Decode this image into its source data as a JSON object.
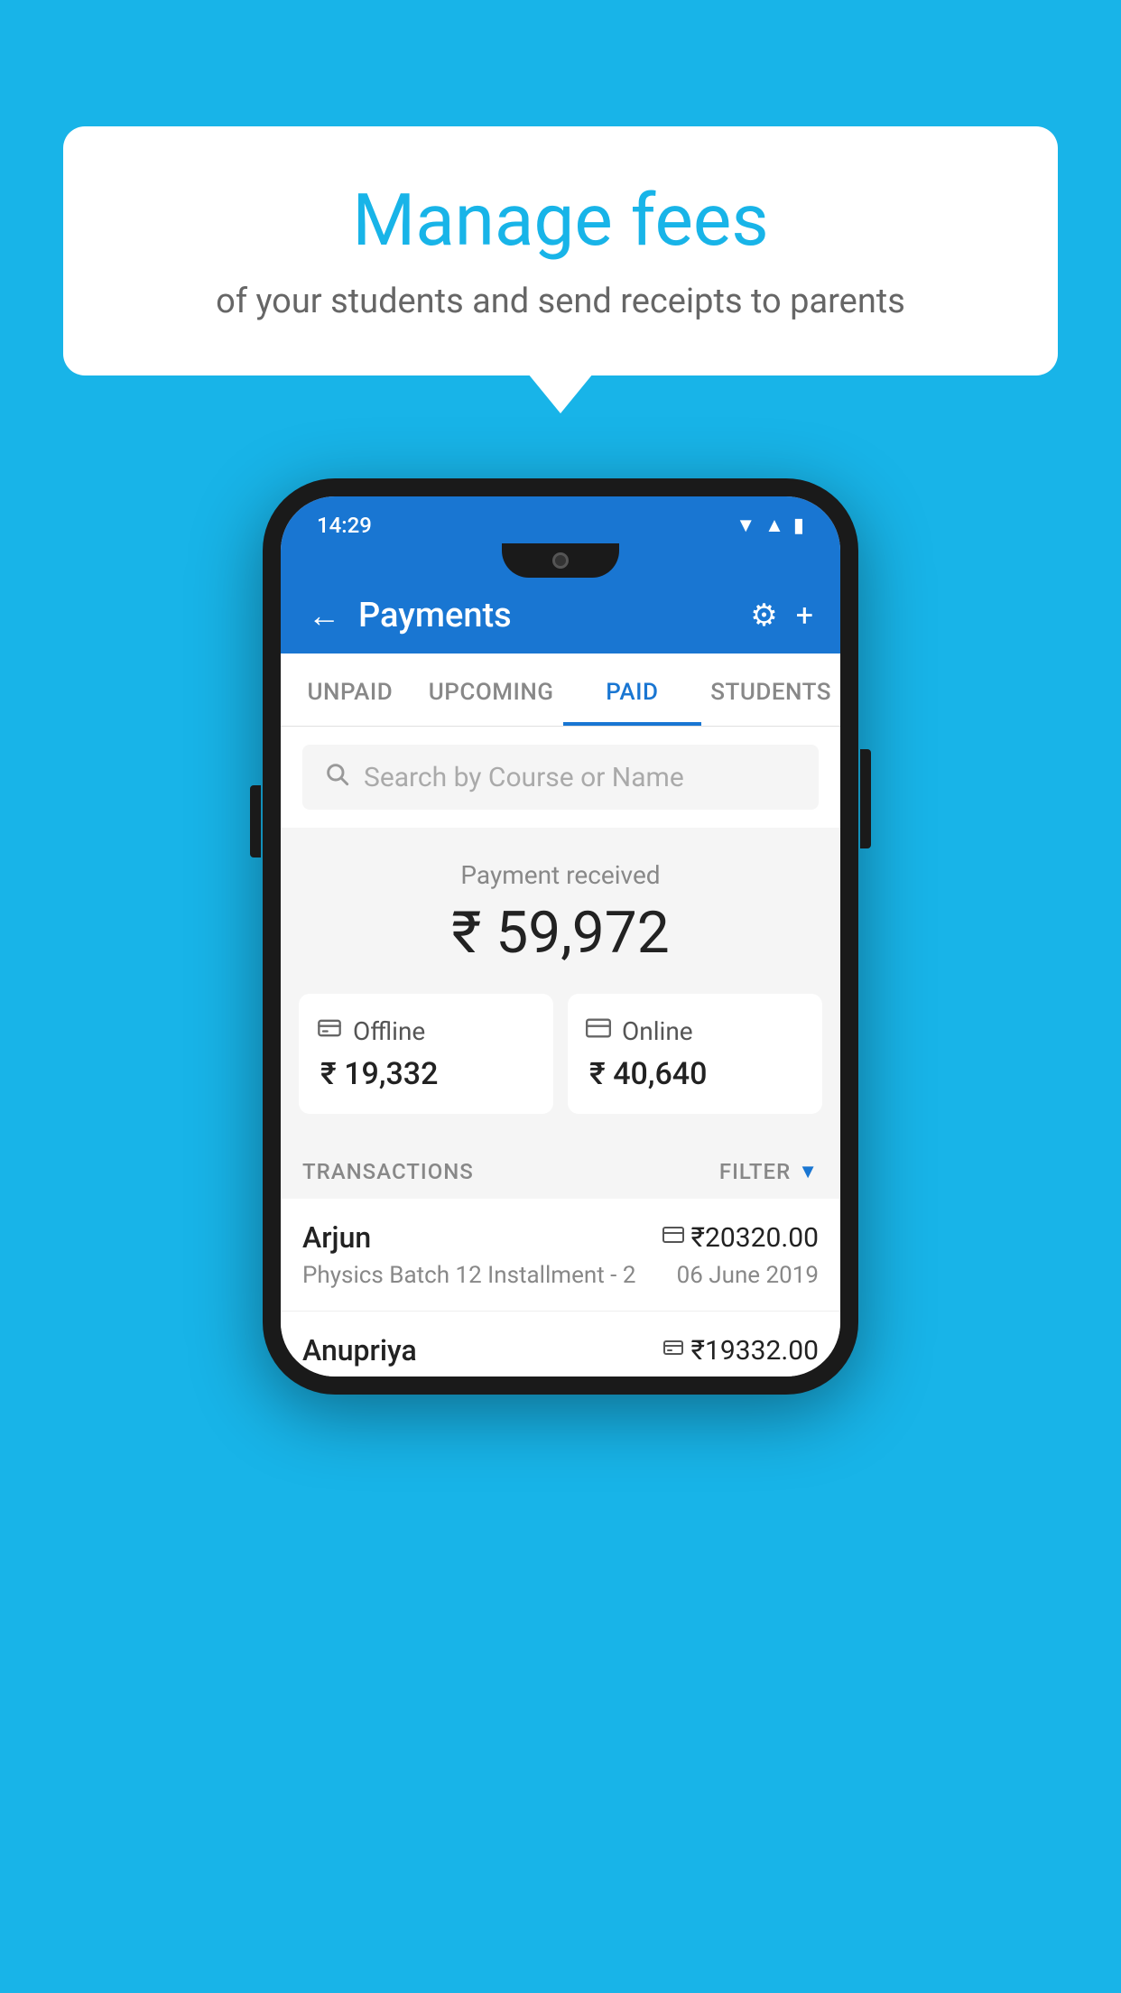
{
  "background_color": "#18b4e8",
  "speech_bubble": {
    "title": "Manage fees",
    "subtitle": "of your students and send receipts to parents"
  },
  "status_bar": {
    "time": "14:29",
    "wifi": "▼",
    "signal": "▲",
    "battery": "▮"
  },
  "app_bar": {
    "title": "Payments",
    "back_label": "←",
    "gear_label": "⚙",
    "plus_label": "+"
  },
  "tabs": [
    {
      "label": "UNPAID",
      "active": false
    },
    {
      "label": "UPCOMING",
      "active": false
    },
    {
      "label": "PAID",
      "active": true
    },
    {
      "label": "STUDENTS",
      "active": false
    }
  ],
  "search": {
    "placeholder": "Search by Course or Name"
  },
  "payment_summary": {
    "label": "Payment received",
    "amount": "₹ 59,972",
    "offline": {
      "label": "Offline",
      "amount": "₹ 19,332"
    },
    "online": {
      "label": "Online",
      "amount": "₹ 40,640"
    }
  },
  "transactions": {
    "section_label": "TRANSACTIONS",
    "filter_label": "FILTER",
    "items": [
      {
        "name": "Arjun",
        "course": "Physics Batch 12 Installment - 2",
        "amount": "₹20320.00",
        "date": "06 June 2019",
        "mode_icon": "card"
      },
      {
        "name": "Anupriya",
        "course": "",
        "amount": "₹19332.00",
        "date": "",
        "mode_icon": "cash"
      }
    ]
  }
}
